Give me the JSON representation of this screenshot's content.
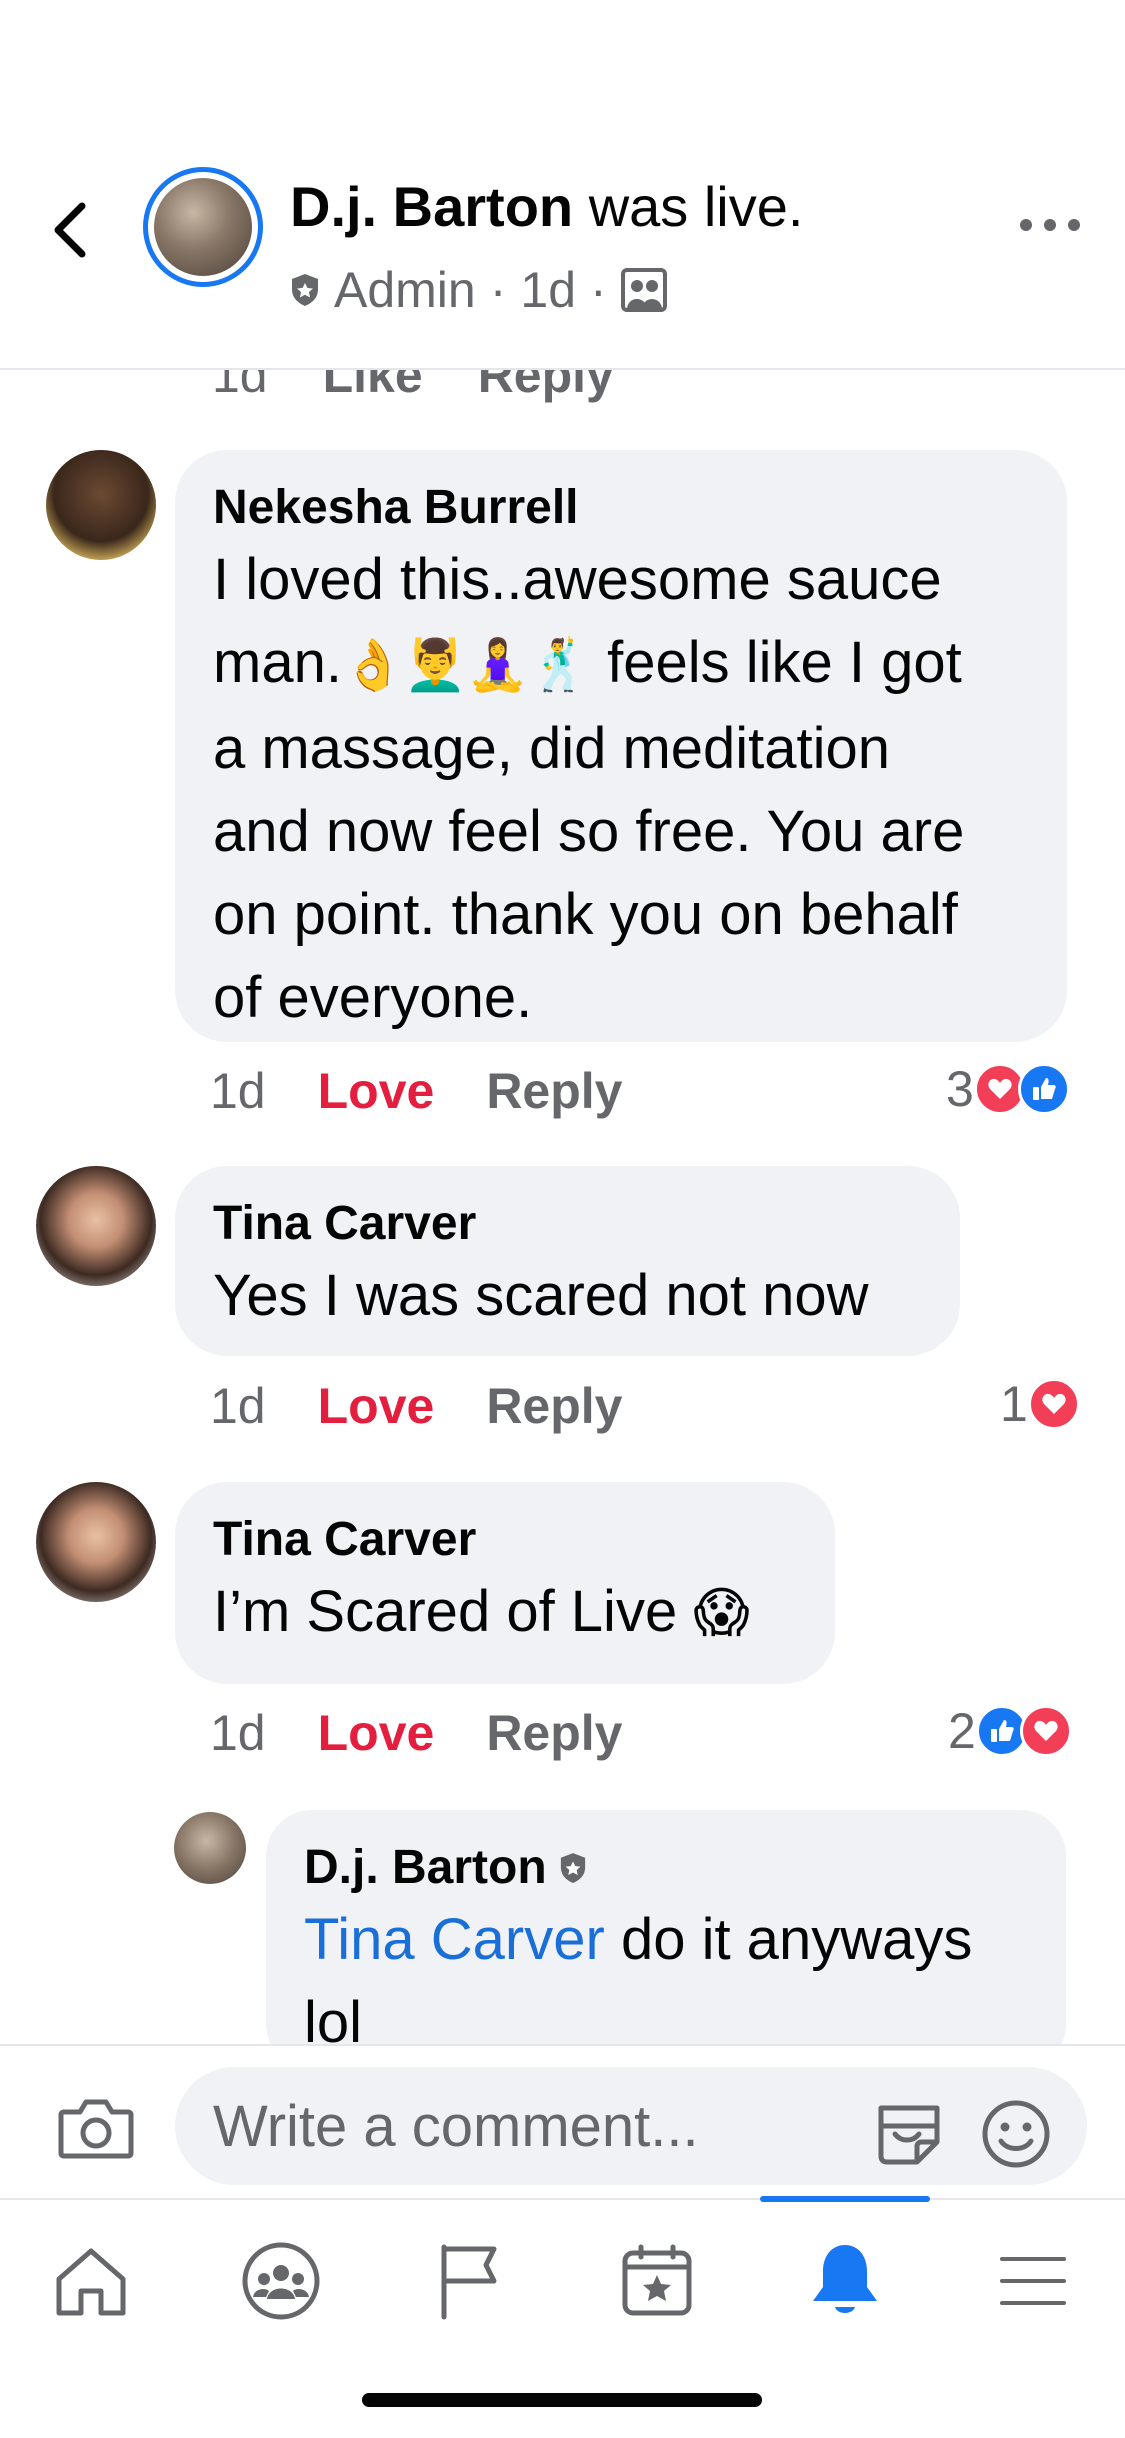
{
  "header": {
    "name": "D.j. Barton",
    "status": "was live.",
    "role": "Admin",
    "time": "1d",
    "separator": "·"
  },
  "previous_meta": {
    "time": "1d",
    "like": "Like",
    "reply": "Reply"
  },
  "comments": [
    {
      "author": "Nekesha Burrell",
      "line1": "I loved this..awesome sauce",
      "line2_pre": "man.",
      "line2_emoji": "👌💆‍♂️🧘‍♀️🕺",
      "line2_post": " feels like I got",
      "line3": "a massage, did meditation",
      "line4": "and now feel so free. You are",
      "line5": "on point. thank you on behalf",
      "line6": "of everyone.",
      "time": "1d",
      "action": "Love",
      "reply": "Reply",
      "reaction_count": "3"
    },
    {
      "author": "Tina Carver",
      "text": "Yes I was scared not now",
      "time": "1d",
      "action": "Love",
      "reply": "Reply",
      "reaction_count": "1"
    },
    {
      "author": "Tina Carver",
      "text": "I’m Scared of Live ",
      "emoji": "😱",
      "time": "1d",
      "action": "Love",
      "reply": "Reply",
      "reaction_count": "2"
    }
  ],
  "reply": {
    "author": "D.j. Barton",
    "mention": "Tina Carver",
    "text_line1": " do it anyways",
    "text_line2": "lol"
  },
  "composer": {
    "placeholder": "Write a comment..."
  },
  "tabs": [
    "home-icon",
    "groups-icon",
    "pages-flag-icon",
    "events-icon",
    "notifications-bell-icon",
    "menu-icon"
  ],
  "colors": {
    "accent": "#1877f2",
    "love": "#e41e3f",
    "bubble": "#f0f2f5",
    "secondary_text": "#65676b"
  }
}
